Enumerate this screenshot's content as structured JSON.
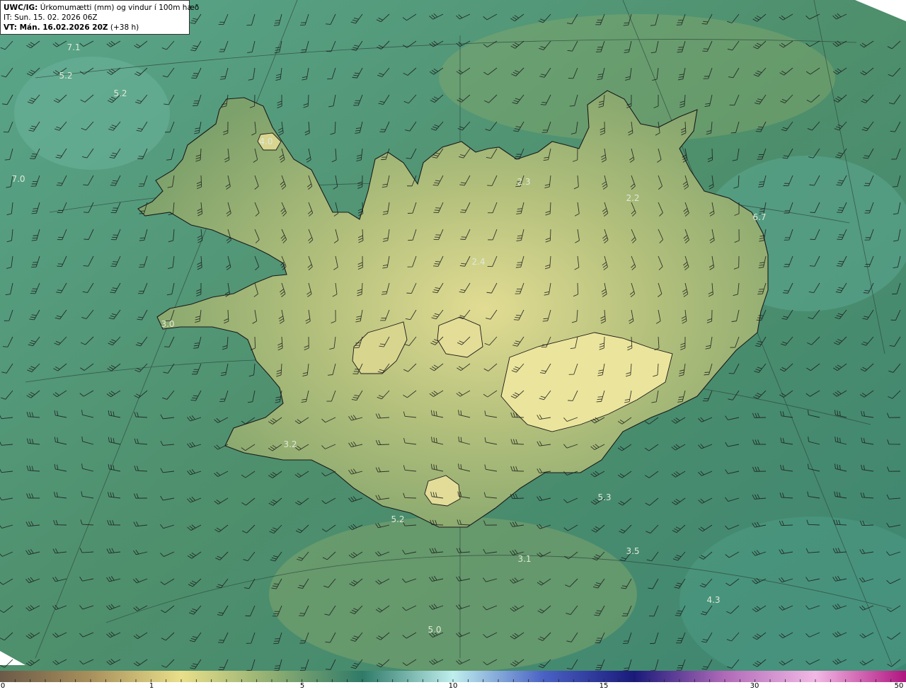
{
  "header": {
    "model_label": "UWC/IG:",
    "title": "Úrkomumætti (mm) og vindur í 100m hæð",
    "init_time": "IT: Sun. 15. 02. 2026 06Z",
    "valid_label": "VT: Mán. 16.02.2026 20Z",
    "valid_offset": "(+38 h)"
  },
  "map_values": [
    {
      "text": "7.1"
    },
    {
      "text": "5.2"
    },
    {
      "text": "5.2"
    },
    {
      "text": "7.0"
    },
    {
      "text": "4.0"
    },
    {
      "text": "2.3"
    },
    {
      "text": "2.2"
    },
    {
      "text": "6.7"
    },
    {
      "text": "2.4"
    },
    {
      "text": "3.0"
    },
    {
      "text": "3.2"
    },
    {
      "text": "5.3"
    },
    {
      "text": "5.2"
    },
    {
      "text": "3.1"
    },
    {
      "text": "3.5"
    },
    {
      "text": "4.3"
    },
    {
      "text": "5.0"
    }
  ],
  "colorbar": {
    "ticks": [
      "0",
      "1",
      "5",
      "10",
      "15",
      "30",
      "50"
    ],
    "colors": [
      "#6b5a48",
      "#a8905c",
      "#e9df8a",
      "#8fae72",
      "#2f7a68",
      "#bfeeee",
      "#4a62c4",
      "#1a1a7a",
      "#b06ab8",
      "#f2b8e4",
      "#b01480"
    ]
  },
  "style": {
    "sea_color": "#3f8a6e",
    "land_color": "#9ab570",
    "coast_color": "#1a1a1a",
    "barb_color": "#1a1a1a",
    "grid_color": "#2f4a3f"
  }
}
